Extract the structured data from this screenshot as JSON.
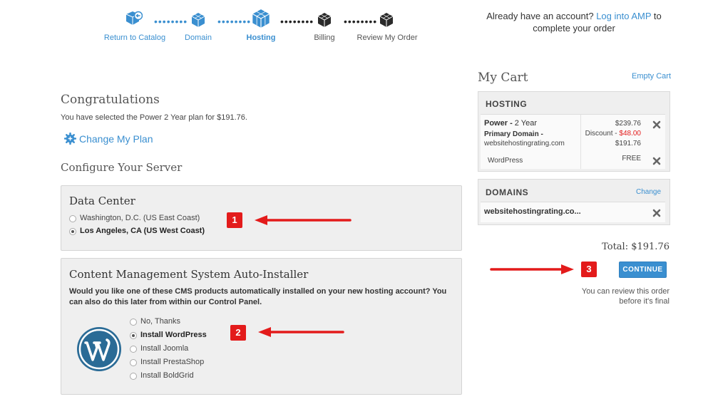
{
  "steps": [
    {
      "label": "Return to Catalog",
      "state": "done"
    },
    {
      "label": "Domain",
      "state": "done"
    },
    {
      "label": "Hosting",
      "state": "current"
    },
    {
      "label": "Billing",
      "state": "pending"
    },
    {
      "label": "Review My Order",
      "state": "pending"
    }
  ],
  "account": {
    "prefix": "Already have an account?",
    "link": "Log into AMP",
    "suffix": "to complete your order"
  },
  "main": {
    "congrats_title": "Congratulations",
    "selected_text": "You have selected the Power 2 Year plan for $191.76.",
    "change_plan": "Change My Plan",
    "configure_title": "Configure Your Server"
  },
  "datacenter": {
    "title": "Data Center",
    "options": [
      {
        "label": "Washington, D.C. (US East Coast)",
        "selected": false
      },
      {
        "label": "Los Angeles, CA (US West Coast)",
        "selected": true
      }
    ]
  },
  "cms": {
    "title": "Content Management System Auto-Installer",
    "description": "Would you like one of these CMS products automatically installed on your new hosting account? You can also do this later from within our Control Panel.",
    "options": [
      {
        "label": "No, Thanks",
        "selected": false
      },
      {
        "label": "Install WordPress",
        "selected": true
      },
      {
        "label": "Install Joomla",
        "selected": false
      },
      {
        "label": "Install PrestaShop",
        "selected": false
      },
      {
        "label": "Install BoldGrid",
        "selected": false
      }
    ]
  },
  "annotations": {
    "badge1": "1",
    "badge2": "2",
    "badge3": "3"
  },
  "cart": {
    "title": "My Cart",
    "empty_link": "Empty Cart",
    "hosting": {
      "header": "HOSTING",
      "plan_name": "Power -",
      "plan_term": "2 Year",
      "primary_domain_label": "Primary Domain -",
      "primary_domain": "websitehostingrating.com",
      "price": "$239.76",
      "discount_label": "Discount -",
      "discount_value": "$48.00",
      "subtotal": "$191.76",
      "addon_name": "WordPress",
      "addon_price": "FREE"
    },
    "domains": {
      "header": "DOMAINS",
      "change_link": "Change",
      "domain": "websitehostingrating.co..."
    },
    "total": "Total: $191.76",
    "continue_label": "CONTINUE",
    "review_note_line1": "You can review this order",
    "review_note_line2": "before it's final"
  },
  "colors": {
    "accent": "#3a8fd0",
    "discount": "#e31b1b",
    "annotation": "#e31b1b"
  }
}
